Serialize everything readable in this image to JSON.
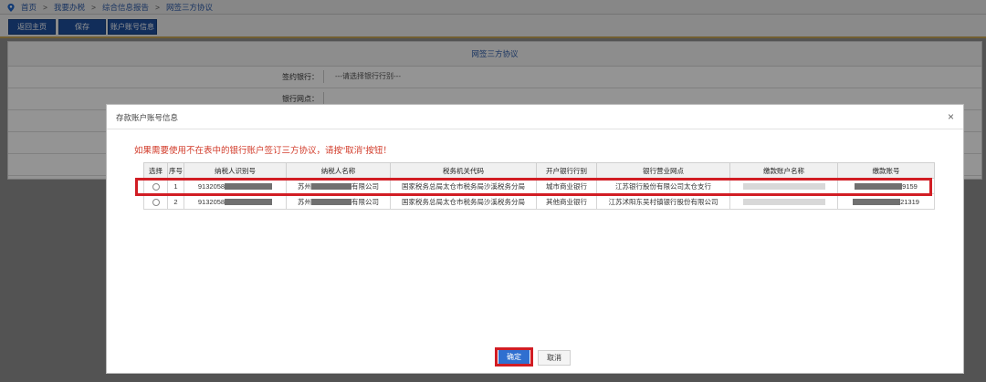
{
  "breadcrumb": [
    "首页",
    "我要办税",
    "综合信息报告",
    "网签三方协议"
  ],
  "breadcrumb_sep": ">",
  "toolbar": {
    "back_label": "返回主页",
    "save_label": "保存",
    "account_label": "账户账号信息"
  },
  "form": {
    "title": "网签三方协议",
    "rows": [
      {
        "label": "签约银行：",
        "value": "---请选择银行行别---"
      },
      {
        "label": "银行网点：",
        "value": ""
      }
    ]
  },
  "modal": {
    "title": "存款账户账号信息",
    "warning": "如果需要使用不在表中的银行账户签订三方协议，请按“取消”按钮！",
    "columns": [
      "选择",
      "序号",
      "纳税人识别号",
      "纳税人名称",
      "税务机关代码",
      "开户银行行别",
      "银行营业网点",
      "缴款账户名称",
      "缴款账号"
    ],
    "rows": [
      {
        "seq": "1",
        "taxpayer_id": "9132058",
        "name_prefix": "苏州",
        "name_suffix": "有限公司",
        "tax_office": "国家税务总局太仓市税务局沙溪税务分局",
        "bank_type": "城市商业银行",
        "branch": "江苏银行股份有限公司太仓支行",
        "account_suffix": "9159"
      },
      {
        "seq": "2",
        "taxpayer_id": "9132058",
        "name_prefix": "苏州",
        "name_suffix": "有限公司",
        "tax_office": "国家税务总局太仓市税务局沙溪税务分局",
        "bank_type": "其他商业银行",
        "branch": "江苏沭阳东吴村镇银行股份有限公司",
        "account_suffix": "21319"
      }
    ],
    "ok_label": "确定",
    "cancel_label": "取消",
    "close_glyph": "×"
  },
  "colors": {
    "accent_red": "#d11d24",
    "primary_blue": "#1e4f9c",
    "warn_text": "#d23b2a"
  }
}
